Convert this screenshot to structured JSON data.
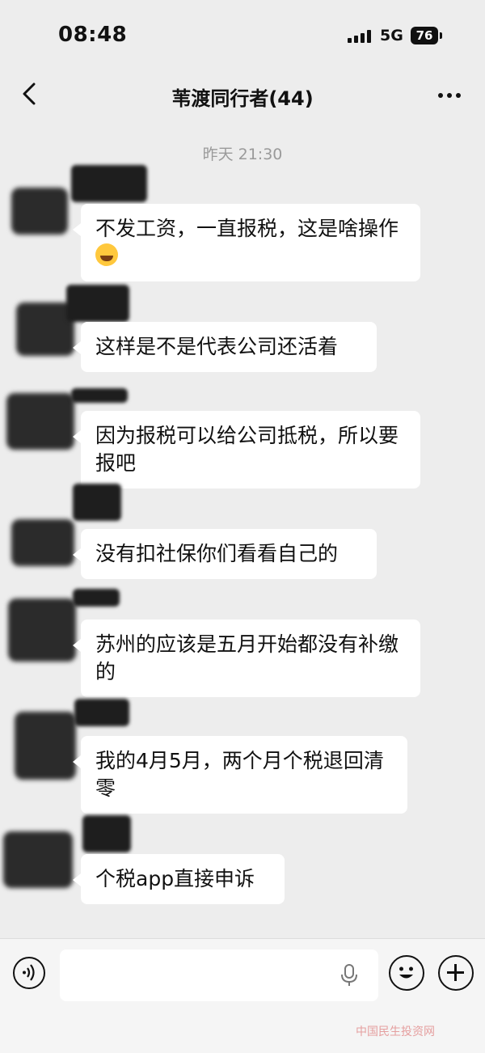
{
  "status": {
    "time": "08:48",
    "network": "5G",
    "battery": "76"
  },
  "header": {
    "title": "苇渡同行者(44)"
  },
  "chat": {
    "time_separator": "昨天 21:30",
    "messages": [
      {
        "text": "不发工资，一直报税，这是啥操作",
        "emoji": "face-with-tears-of-joy-icon"
      },
      {
        "text": "这样是不是代表公司还活着"
      },
      {
        "text": "因为报税可以给公司抵税，所以要报吧"
      },
      {
        "text": "没有扣社保你们看看自己的"
      },
      {
        "text": "苏州的应该是五月开始都没有补缴的"
      },
      {
        "text": "我的4月5月，两个月个税退回清零"
      },
      {
        "text": "个税app直接申诉"
      }
    ]
  },
  "input_bar": {
    "voice_icon": "voice-icon",
    "mic_icon": "mic-icon",
    "emoji_icon": "smile-icon",
    "plus_icon": "plus-icon"
  },
  "watermark": "中国民生投资网"
}
